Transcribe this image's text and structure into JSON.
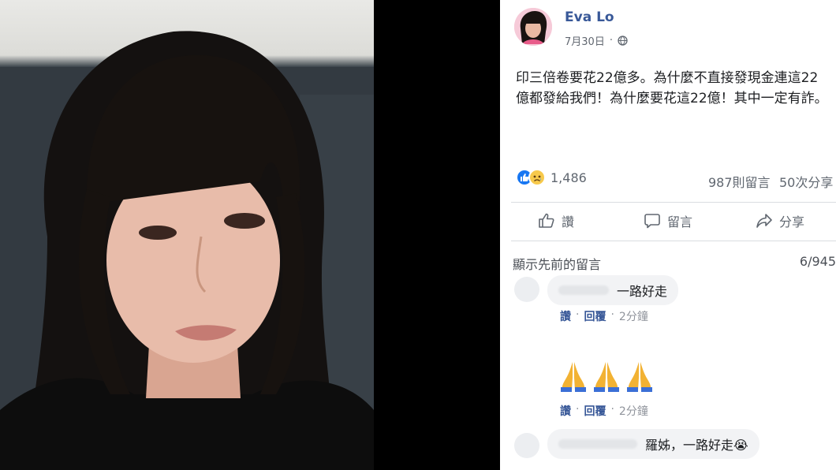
{
  "post": {
    "author": "Eva Lo",
    "date": "7月30日",
    "text": "印三倍卷要花22億多。為什麼不直接發現金連這22億都發給我們！為什麼要花這22億！其中一定有詐。",
    "reaction_count": "1,486",
    "comments_count": "987則留言",
    "shares_count": "50次分享"
  },
  "actions": {
    "like": "讚",
    "comment": "留言",
    "share": "分享"
  },
  "comments_section": {
    "show_previous": "顯示先前的留言",
    "counter": "6/945",
    "items": [
      {
        "text": "一路好走",
        "like": "讚",
        "sep": "·",
        "reply": "回覆",
        "time": "2分鐘"
      },
      {
        "emoji": "🙏🙏🙏",
        "like": "讚",
        "sep": "·",
        "reply": "回覆",
        "time": "2分鐘"
      },
      {
        "text": "羅姊，一路好走😭"
      }
    ]
  },
  "icons": {
    "globe": "globe-icon",
    "like": "thumbs-up-icon",
    "comment": "speech-bubble-icon",
    "share": "share-arrow-icon",
    "reaction_like": "like-reaction-icon",
    "reaction_sad": "sad-reaction-icon",
    "pray": "folded-hands-icon"
  },
  "colors": {
    "link": "#385898",
    "like_blue": "#1877f2",
    "sad_yellow": "#f7c94b",
    "muted": "#606770"
  }
}
